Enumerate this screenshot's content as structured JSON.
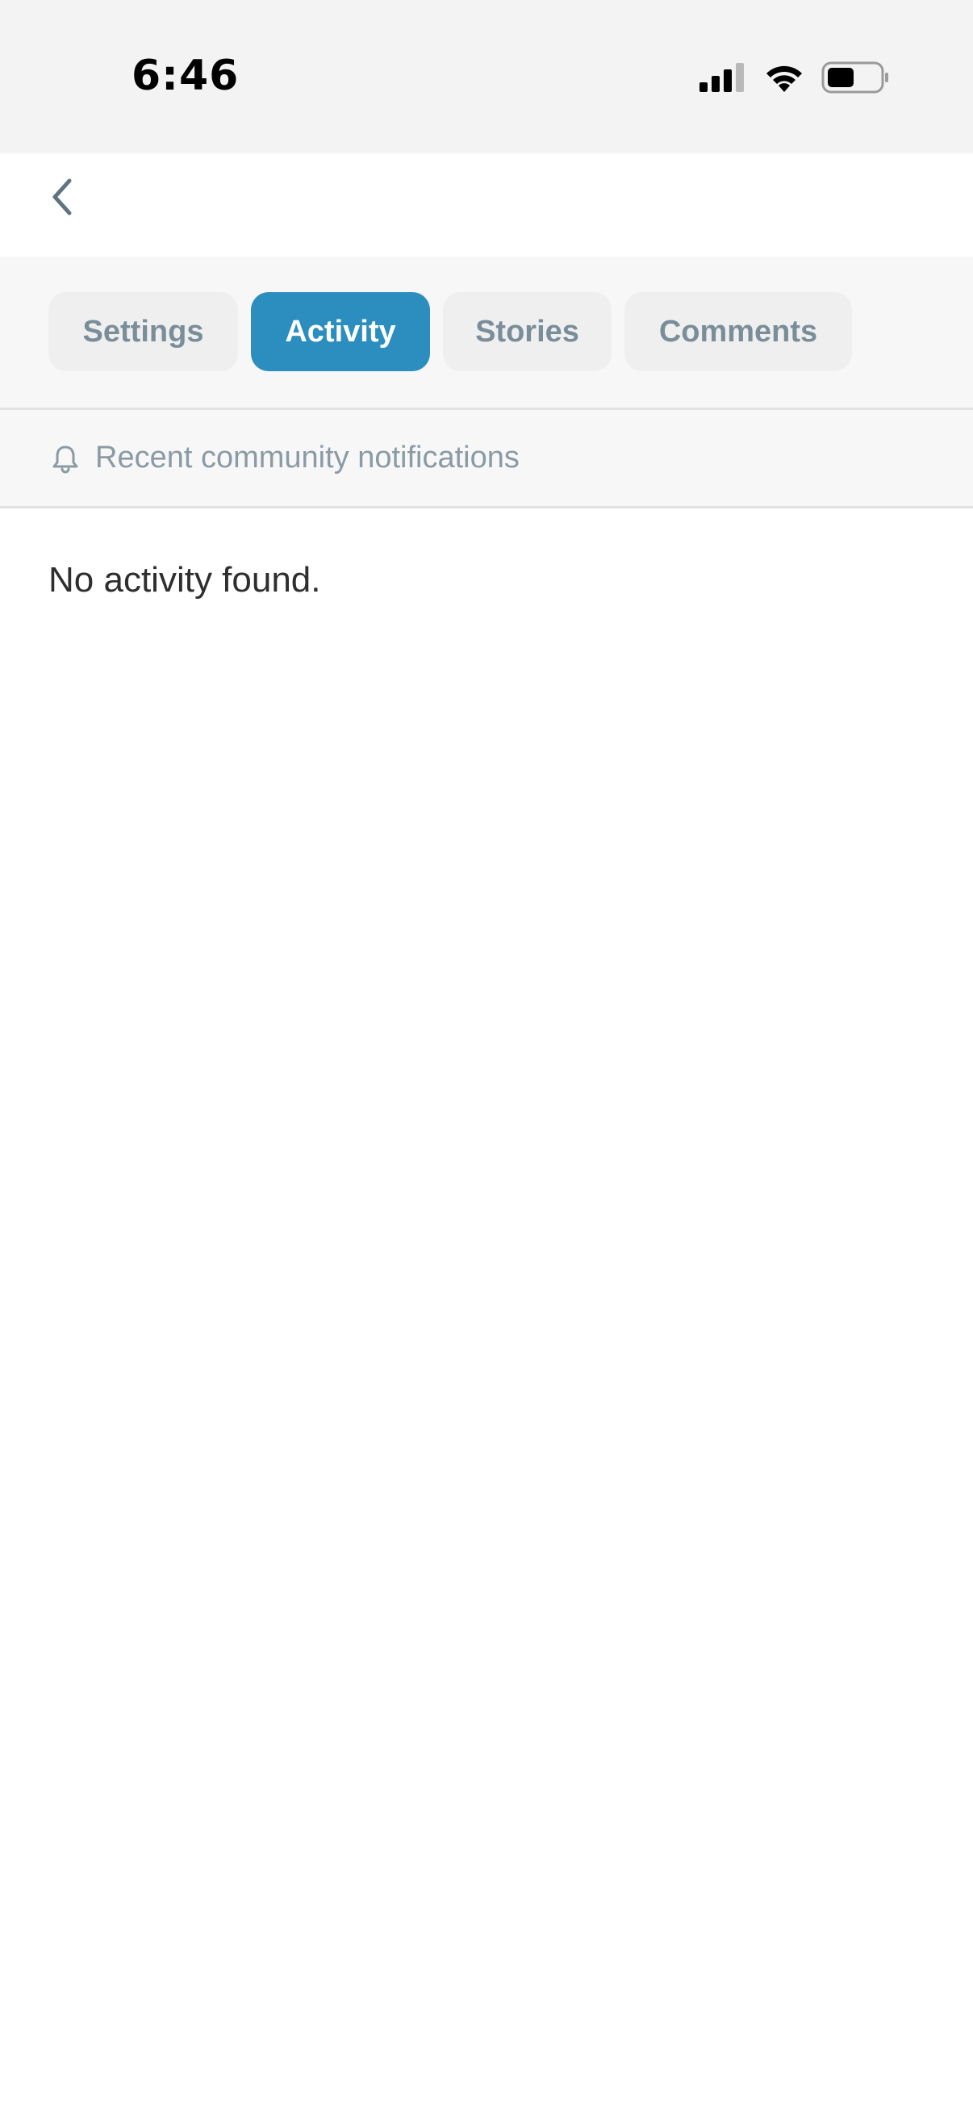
{
  "status_bar": {
    "time": "6:46",
    "icons": [
      "signal-icon",
      "wifi-icon",
      "battery-icon"
    ]
  },
  "nav": {
    "back_icon": "chevron-left-icon"
  },
  "tabs": [
    {
      "label": "Settings",
      "active": false
    },
    {
      "label": "Activity",
      "active": true
    },
    {
      "label": "Stories",
      "active": false
    },
    {
      "label": "Comments",
      "active": false
    }
  ],
  "subheader": {
    "icon": "bell-icon",
    "text": "Recent community notifications"
  },
  "content": {
    "empty_message": "No activity found."
  },
  "colors": {
    "accent": "#2b8ebf",
    "tab_inactive_bg": "#efefef",
    "tab_inactive_text": "#7a8e9a",
    "muted_text": "#8a9ba5"
  }
}
